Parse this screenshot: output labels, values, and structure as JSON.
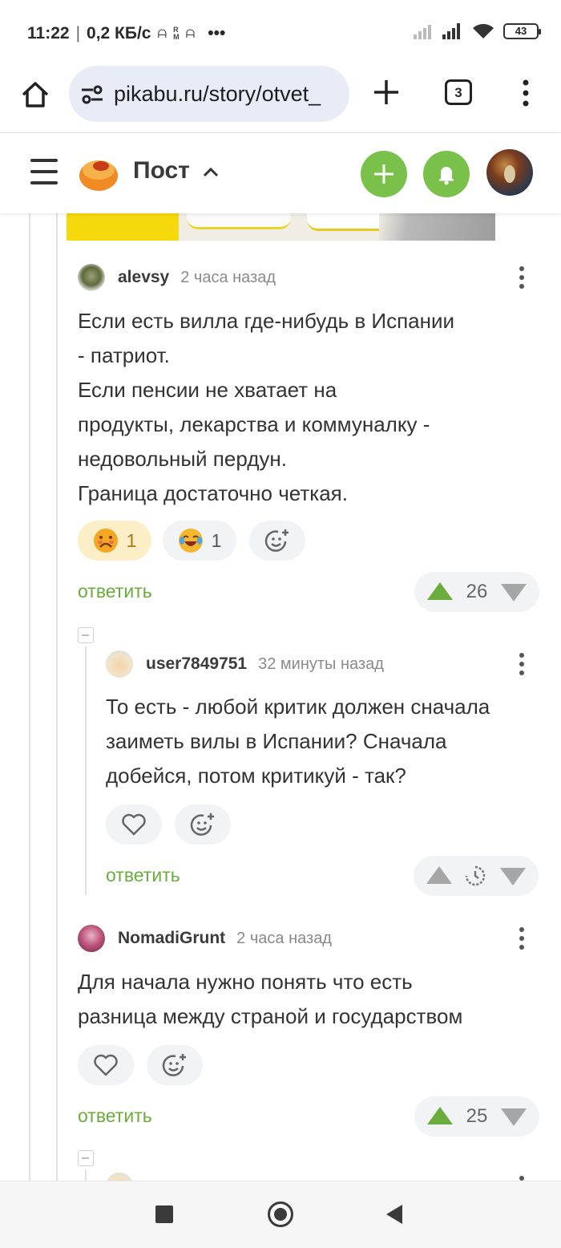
{
  "status_bar": {
    "time": "11:22",
    "speed": "0,2 КБ/с",
    "overflow": "•••",
    "battery": "43"
  },
  "browser": {
    "url": "pikabu.ru/story/otvet_",
    "tab_count": "3"
  },
  "header": {
    "title": "Пост",
    "colors": {
      "accent": "#7ac14b",
      "logo": "#f08a24"
    }
  },
  "comments": [
    {
      "user": "alevsy",
      "time": "2 часа назад",
      "text": "Если есть вилла где-нибудь в Испании\n- патриот.\nЕсли пенсии не хватает на\nпродукты, лекарства и коммуналку -\nнедовольный пердун.\nГраница достаточно четкая.",
      "reactions": [
        {
          "icon": "sad-face-emoji-icon",
          "count": "1"
        },
        {
          "icon": "laughing-crying-emoji-icon",
          "count": "1"
        }
      ],
      "reply_label": "ответить",
      "rating": "26"
    },
    {
      "user": "user7849751",
      "time": "32 минуты назад",
      "text": "То есть - любой критик должен сначала\nзаиметь вилы в Испании? Сначала\nдобейся, потом критикуй - так?",
      "reply_label": "ответить",
      "rating_pending": true
    },
    {
      "user": "NomadiGrunt",
      "time": "2 часа назад",
      "text": "Для начала нужно понять что есть\nразница между страной и государством",
      "reply_label": "ответить",
      "rating": "25"
    }
  ]
}
